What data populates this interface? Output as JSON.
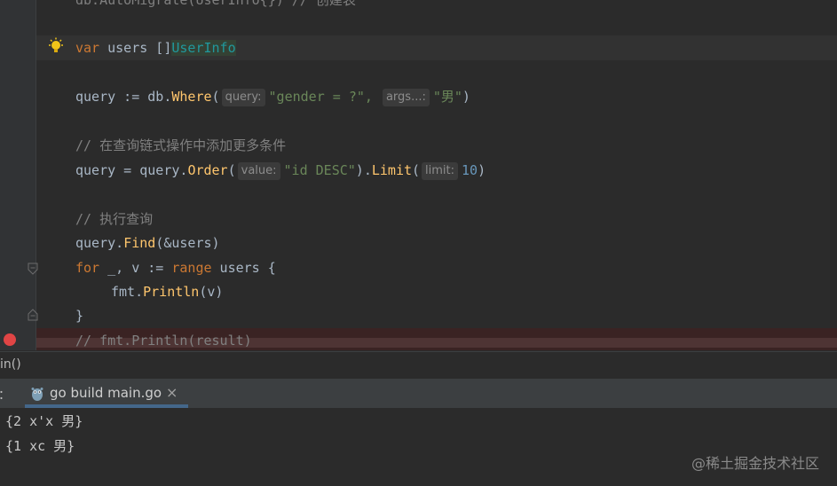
{
  "editor": {
    "lines": {
      "l0": {
        "text": "db.AutoMigrate(UserInfo{}) // 创建表"
      },
      "l1": {
        "kw": "var",
        "name": " users []",
        "type": "UserInfo"
      },
      "l2": {
        "a": "query := db.",
        "fn": "Where",
        "b": "(",
        "hint1": "query:",
        "s1": "\"gender = ?\",",
        "hint2": "args...:",
        "s2": "\"男\"",
        "c": ")"
      },
      "l3": {
        "comment": "// 在查询链式操作中添加更多条件"
      },
      "l4": {
        "a": "query = query.",
        "fn1": "Order",
        "b": "(",
        "hint1": "value:",
        "s1": "\"id DESC\"",
        "c": ").",
        "fn2": "Limit",
        "d": "(",
        "hint2": "limit:",
        "num": "10",
        "e": ")"
      },
      "l5": {
        "comment": "// 执行查询"
      },
      "l6": {
        "a": "query.",
        "fn": "Find",
        "b": "(&users)"
      },
      "l7": {
        "kw1": "for",
        "a": " _, v := ",
        "kw2": "range",
        "b": " users {"
      },
      "l8": {
        "a": "fmt.",
        "fn": "Println",
        "b": "(v)"
      },
      "l9": {
        "text": "}"
      },
      "l10": {
        "comment": "// fmt.Println(result)"
      }
    }
  },
  "breadcrumb": {
    "text": "in()"
  },
  "run": {
    "label": "：",
    "tab_label": "go build main.go",
    "close": "×"
  },
  "console": {
    "lines": [
      "{2 x'x 男}",
      "{1 xc 男}"
    ]
  },
  "watermark": "@稀土掘金技术社区",
  "colors": {
    "keyword": "#cc7832",
    "function": "#ffc66d",
    "string": "#6a8759",
    "number": "#6897bb",
    "comment": "#808080",
    "breakpoint": "#e04545"
  }
}
